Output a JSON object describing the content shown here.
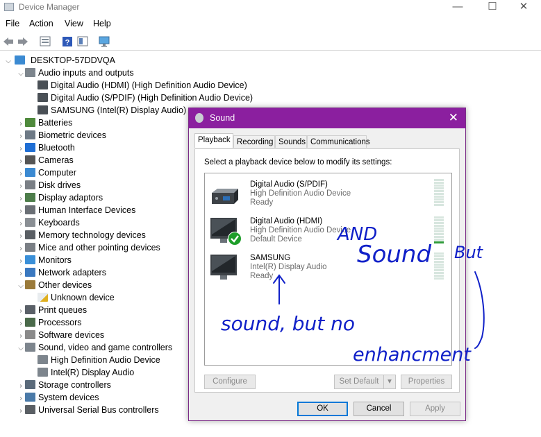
{
  "window": {
    "title": "Device Manager",
    "minimize_glyph": "—",
    "maximize_glyph": "☐",
    "close_glyph": "✕"
  },
  "menu": [
    "File",
    "Action",
    "View",
    "Help"
  ],
  "toolbar_icons": [
    "back-icon",
    "forward-icon",
    "properties-sheet-icon",
    "help-icon",
    "show-hidden-icon",
    "monitor-scan-icon"
  ],
  "tree": {
    "root": "DESKTOP-57DDVQA",
    "items": [
      {
        "label": "Audio inputs and outputs",
        "expanded": true,
        "icon": "speaker-icon"
      },
      {
        "label": "Digital Audio (HDMI) (High Definition Audio Device)",
        "child": true,
        "icon": "audio-device-icon"
      },
      {
        "label": "Digital Audio (S/PDIF) (High Definition Audio Device)",
        "child": true,
        "icon": "audio-device-icon"
      },
      {
        "label": "SAMSUNG (Intel(R) Display Audio)",
        "child": true,
        "icon": "audio-device-icon"
      },
      {
        "label": "Batteries",
        "icon": "battery-icon"
      },
      {
        "label": "Biometric devices",
        "icon": "fingerprint-icon"
      },
      {
        "label": "Bluetooth",
        "icon": "bluetooth-icon"
      },
      {
        "label": "Cameras",
        "icon": "camera-icon"
      },
      {
        "label": "Computer",
        "icon": "computer-icon"
      },
      {
        "label": "Disk drives",
        "icon": "disk-icon"
      },
      {
        "label": "Display adaptors",
        "icon": "display-adapter-icon"
      },
      {
        "label": "Human Interface Devices",
        "icon": "hid-icon"
      },
      {
        "label": "Keyboards",
        "icon": "keyboard-icon"
      },
      {
        "label": "Memory technology devices",
        "icon": "memory-icon"
      },
      {
        "label": "Mice and other pointing devices",
        "icon": "mouse-icon"
      },
      {
        "label": "Monitors",
        "icon": "monitor-icon"
      },
      {
        "label": "Network adapters",
        "icon": "network-icon"
      },
      {
        "label": "Other devices",
        "expanded": true,
        "icon": "other-devices-icon"
      },
      {
        "label": "Unknown device",
        "child": true,
        "icon": "warning-icon"
      },
      {
        "label": "Print queues",
        "icon": "printer-icon"
      },
      {
        "label": "Processors",
        "icon": "processor-icon"
      },
      {
        "label": "Software devices",
        "icon": "software-device-icon"
      },
      {
        "label": "Sound, video and game controllers",
        "expanded": true,
        "icon": "speaker-icon"
      },
      {
        "label": "High Definition Audio Device",
        "child": true,
        "icon": "speaker-icon"
      },
      {
        "label": "Intel(R) Display Audio",
        "child": true,
        "icon": "speaker-icon"
      },
      {
        "label": "Storage controllers",
        "icon": "storage-icon"
      },
      {
        "label": "System devices",
        "icon": "system-icon"
      },
      {
        "label": "Universal Serial Bus controllers",
        "icon": "usb-icon"
      }
    ]
  },
  "sound_dialog": {
    "title": "Sound",
    "close_glyph": "✕",
    "tabs": [
      "Playback",
      "Recording",
      "Sounds",
      "Communications"
    ],
    "active_tab": "Playback",
    "instruction": "Select a playback device below to modify its settings:",
    "devices": [
      {
        "name": "Digital Audio (S/PDIF)",
        "driver": "High Definition Audio Device",
        "status": "Ready",
        "icon": "spdif-device-icon",
        "default": false
      },
      {
        "name": "Digital Audio (HDMI)",
        "driver": "High Definition Audio Device",
        "status": "Default Device",
        "icon": "hdmi-monitor-icon",
        "default": true
      },
      {
        "name": "SAMSUNG",
        "driver": "Intel(R) Display Audio",
        "status": "Ready",
        "icon": "samsung-monitor-icon",
        "default": false
      }
    ],
    "buttons": {
      "configure": "Configure",
      "set_default": "Set Default",
      "properties": "Properties",
      "ok": "OK",
      "cancel": "Cancel",
      "apply": "Apply"
    },
    "colors": {
      "title_bar": "#8b1f9f",
      "default_check": "#1e9e2a"
    }
  },
  "annotations": {
    "color": "#1020c8",
    "hdmi_note": [
      "AND",
      "Sound",
      "But"
    ],
    "samsung_note": "sound, but no",
    "right_note": "enhancment"
  }
}
